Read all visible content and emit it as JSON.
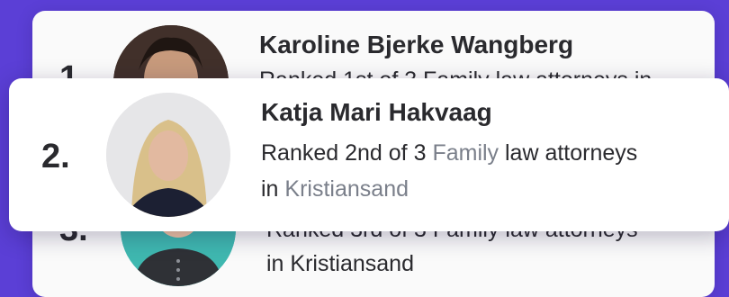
{
  "entries": [
    {
      "rank": "1.",
      "name": "Karoline Bjerke Wangberg",
      "desc_prefix": "Ranked 1st of 3 Family law attorneys in",
      "location": ""
    },
    {
      "rank": "2.",
      "name": "Katja Mari Hakvaag",
      "desc_prefix": "Ranked 2nd of 3",
      "practice": "Family",
      "desc_suffix": "law attorneys",
      "desc_in": "in",
      "location": "Kristiansand"
    },
    {
      "rank": "3.",
      "desc_prefix": "Ranked 3rd of 3 Family law attorneys",
      "location": "in Kristiansand"
    }
  ],
  "colors": {
    "background": "#5b3fd6",
    "avatar3_bg": "#3fb8b0"
  },
  "icons": [
    "person-icon"
  ]
}
